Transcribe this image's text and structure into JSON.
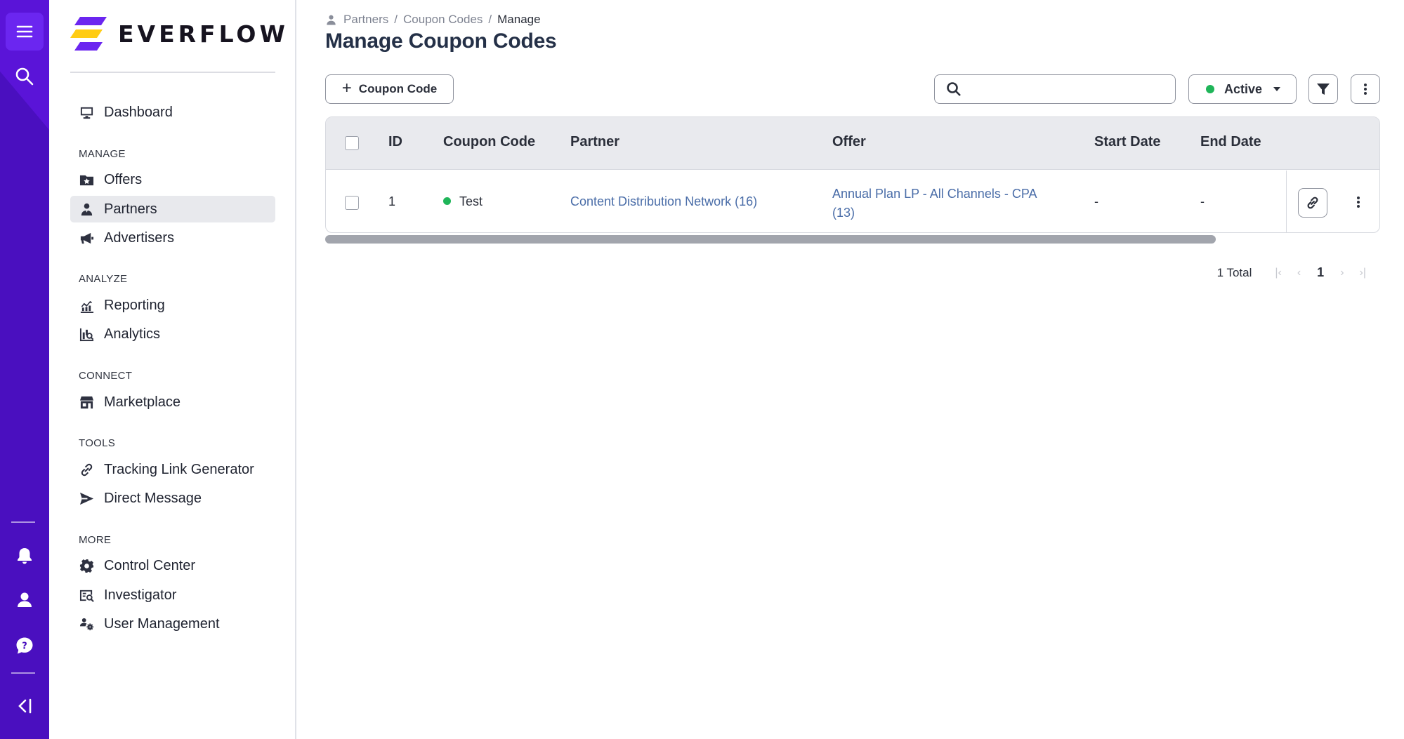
{
  "app": {
    "brand": "EVERFLOW",
    "colors": {
      "rail": "#4a0fbf",
      "accent": "#6b26f0",
      "link": "#4a6da8",
      "status_active": "#1fb559"
    }
  },
  "rail": {
    "top": [
      {
        "icon": "menu-icon"
      },
      {
        "icon": "search-icon"
      }
    ],
    "bottom": [
      {
        "icon": "bell-icon"
      },
      {
        "icon": "user-icon"
      },
      {
        "icon": "help-icon"
      },
      {
        "icon": "collapse-sidebar-icon"
      }
    ]
  },
  "sidebar": {
    "items": [
      {
        "label": "Dashboard",
        "icon": "monitor-icon"
      },
      {
        "label": "Offers",
        "icon": "offers-folder-icon"
      },
      {
        "label": "Partners",
        "icon": "partners-icon",
        "active": true
      },
      {
        "label": "Advertisers",
        "icon": "megaphone-icon"
      },
      {
        "label": "Reporting",
        "icon": "reporting-icon"
      },
      {
        "label": "Analytics",
        "icon": "analytics-icon"
      },
      {
        "label": "Marketplace",
        "icon": "marketplace-icon"
      },
      {
        "label": "Tracking Link Generator",
        "icon": "link-icon"
      },
      {
        "label": "Direct Message",
        "icon": "send-icon"
      },
      {
        "label": "Control Center",
        "icon": "gear-icon"
      },
      {
        "label": "Investigator",
        "icon": "investigator-icon"
      },
      {
        "label": "User Management",
        "icon": "user-management-icon"
      }
    ],
    "headings": {
      "manage": "MANAGE",
      "analyze": "ANALYZE",
      "connect": "CONNECT",
      "tools": "TOOLS",
      "more": "MORE"
    }
  },
  "breadcrumb": {
    "items": [
      "Partners",
      "Coupon Codes",
      "Manage"
    ],
    "separator": "/"
  },
  "page": {
    "title": "Manage Coupon Codes"
  },
  "toolbar": {
    "add_label": "Coupon Code",
    "search_placeholder": "",
    "search_value": "",
    "status_filter": "Active"
  },
  "table": {
    "columns": [
      "ID",
      "Coupon Code",
      "Partner",
      "Offer",
      "Start Date",
      "End Date"
    ],
    "rows": [
      {
        "id": "1",
        "coupon_code": "Test",
        "status": "active",
        "partner": "Content Distribution Network (16)",
        "offer_line1": "Annual Plan LP - All Channels - CPA",
        "offer_line2": "(13)",
        "start_date": "-",
        "end_date": "-"
      }
    ]
  },
  "pagination": {
    "total_label": "1 Total",
    "current_page": "1",
    "first": "|‹",
    "prev": "‹",
    "next": "›",
    "last": "›|"
  }
}
